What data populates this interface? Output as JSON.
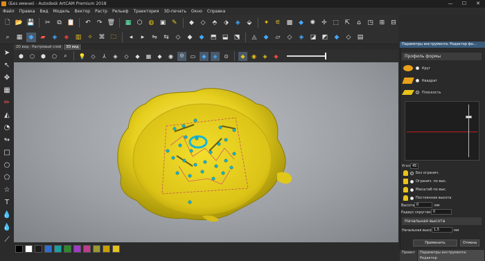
{
  "window": {
    "title": "(Без имени) - Autodesk ArtCAM Premium 2018",
    "min": "—",
    "max": "☐",
    "close": "✕"
  },
  "menu": [
    "Файл",
    "Правка",
    "Вид",
    "Модель",
    "Вектор",
    "Растр",
    "Рельеф",
    "Траектория",
    "3D-печать",
    "Окно",
    "Справка"
  ],
  "view_tabs": [
    {
      "label": "2D вид - Растровый слой",
      "active": false
    },
    {
      "label": "3D вид",
      "active": true
    }
  ],
  "panel": {
    "title": "Параметры инструмента: Редактор фо...",
    "profile_section": "Профиль формы",
    "shapes": [
      {
        "label": "Круг",
        "selected": false
      },
      {
        "label": "Квадрат",
        "selected": false
      },
      {
        "label": "Плоскость",
        "selected": true
      }
    ],
    "angle_label": "Угол",
    "angle_value": "45",
    "limits": [
      {
        "label": "Без огранич.",
        "selected": true
      },
      {
        "label": "Огранич. по выс.",
        "selected": false
      },
      {
        "label": "Масштаб по выс.",
        "selected": false
      },
      {
        "label": "Постоянная высота",
        "selected": false
      }
    ],
    "height_label": "Высота",
    "height_value": "0",
    "height_unit": "мм",
    "radius_label": "Радиус скругления",
    "radius_value": "0",
    "start_height_section": "Начальная высота",
    "start_height_label": "Начальная высота",
    "start_height_value": "1,5",
    "start_height_unit": "мм",
    "apply": "Применить",
    "cancel": "Отмена"
  },
  "bottom_tabs": [
    {
      "label": "Проект",
      "active": false
    },
    {
      "label": "Параметры инструмента: Редактор",
      "active": true
    }
  ],
  "palette_colors": [
    "#000000",
    "#ffffff",
    "#1a1a1a",
    "#2f6fd0",
    "#1aa0a0",
    "#2c8a2c",
    "#a03ac8",
    "#c03c8a",
    "#9a9a30",
    "#c8a000",
    "#e8c31a"
  ],
  "colors": {
    "wax": "#e6cf1e",
    "accent": "#3a5a7a",
    "vector": "#17b5d6",
    "graph_line": "#c02020"
  }
}
